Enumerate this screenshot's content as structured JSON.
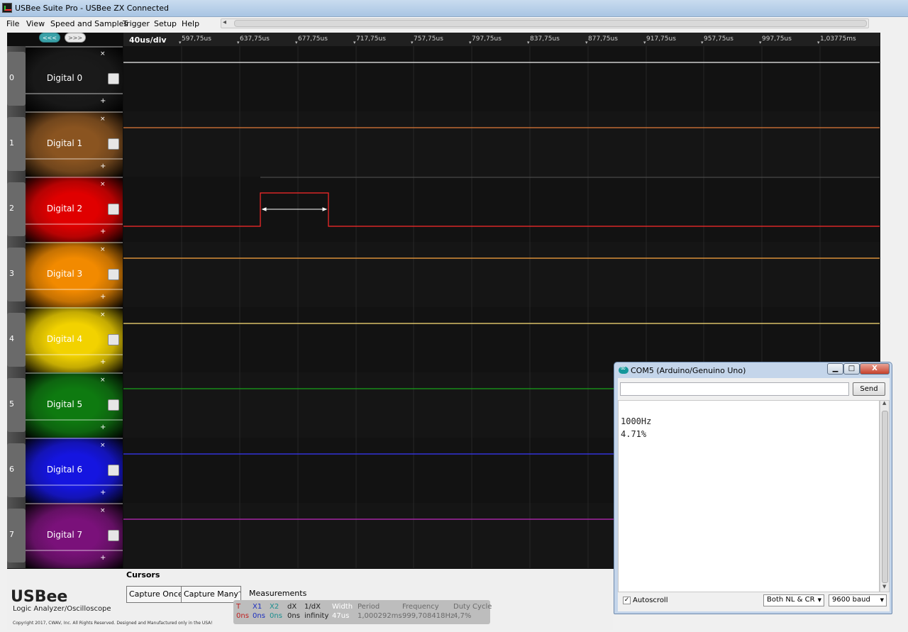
{
  "window": {
    "title": "USBee Suite Pro - USBee ZX Connected"
  },
  "menu": [
    "File",
    "View",
    "Speed and Samples",
    "Trigger",
    "Setup",
    "Help"
  ],
  "nav": {
    "prev": "<<<",
    "next": ">>>"
  },
  "timebar": {
    "div_label": "40us/div",
    "ticks": [
      "597,75us",
      "637,75us",
      "677,75us",
      "717,75us",
      "757,75us",
      "797,75us",
      "837,75us",
      "877,75us",
      "917,75us",
      "957,75us",
      "997,75us",
      "1,03775ms"
    ]
  },
  "channels": [
    {
      "num": "0",
      "name": "Digital 0",
      "color": "#1a1a1a",
      "trace_color": "#f2f2f2"
    },
    {
      "num": "1",
      "name": "Digital 1",
      "color": "#8a5420",
      "trace_color": "#e07b39"
    },
    {
      "num": "2",
      "name": "Digital 2",
      "color": "#e00000",
      "trace_color": "#ff2b2b"
    },
    {
      "num": "3",
      "name": "Digital 3",
      "color": "#f28a00",
      "trace_color": "#ffa640"
    },
    {
      "num": "4",
      "name": "Digital 4",
      "color": "#f2d200",
      "trace_color": "#ffe27a"
    },
    {
      "num": "5",
      "name": "Digital 5",
      "color": "#0e7a10",
      "trace_color": "#19a51b"
    },
    {
      "num": "6",
      "name": "Digital 6",
      "color": "#1515e0",
      "trace_color": "#3a3aff"
    },
    {
      "num": "7",
      "name": "Digital 7",
      "color": "#7a117a",
      "trace_color": "#c029c0"
    }
  ],
  "channel_marks": {
    "minus": "×",
    "plus": "+"
  },
  "bottom": {
    "cursors_label": "Cursors",
    "capture_once": "Capture Once",
    "capture_many": "Capture Many",
    "brand": "USBee",
    "brand_sub": "Logic Analyzer/Oscilloscope",
    "copyright": "Copyright 2017, CWAV, Inc. All Rights Reserved. Designed and Manufactured only in the USA!",
    "measurements_title": "Measurements",
    "measurements": [
      {
        "h": "T",
        "v": "0ns",
        "color": "#c02020"
      },
      {
        "h": "X1",
        "v": "0ns",
        "color": "#1c2fbf"
      },
      {
        "h": "X2",
        "v": "0ns",
        "color": "#1a8f8f"
      },
      {
        "h": "dX",
        "v": "0ns",
        "color": "#222222"
      },
      {
        "h": "1/dX",
        "v": "infinity",
        "color": "#222222"
      },
      {
        "h": "Width",
        "v": "47us",
        "color": "#ffffff"
      },
      {
        "h": "Period",
        "v": "1,000292ms",
        "color": "#6b6b6b"
      },
      {
        "h": "Frequency",
        "v": "999,708418Hz",
        "color": "#6b6b6b"
      },
      {
        "h": "Duty Cycle",
        "v": "4,7%",
        "color": "#6b6b6b"
      }
    ]
  },
  "serial": {
    "title": "COM5 (Arduino/Genuino Uno)",
    "min": "▁",
    "max": "□",
    "close": "X",
    "input_value": "",
    "send": "Send",
    "output": [
      "1000Hz",
      "4.71%"
    ],
    "autoscroll_label": "Autoscroll",
    "autoscroll_check": "✓",
    "line_ending": "Both NL & CR",
    "baud": "9600 baud"
  }
}
